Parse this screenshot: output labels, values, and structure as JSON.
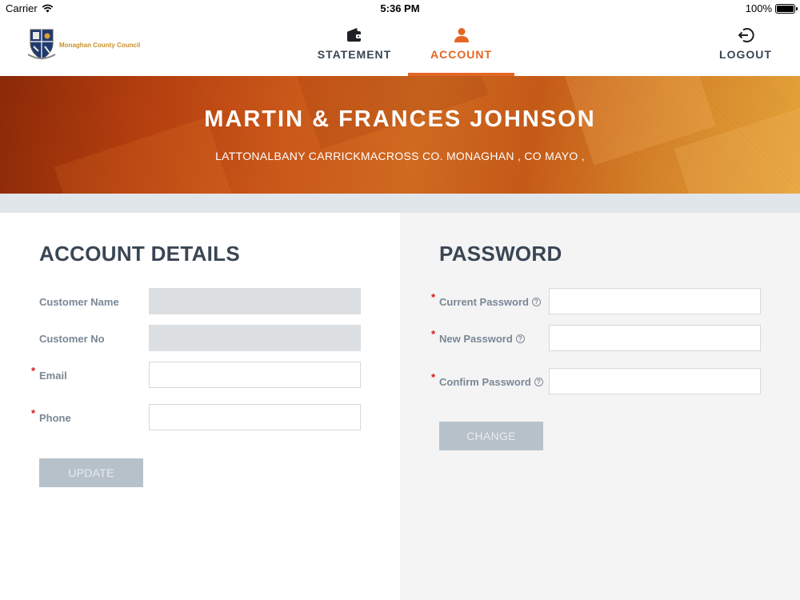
{
  "status_bar": {
    "carrier": "Carrier",
    "time": "5:36 PM",
    "battery": "100%"
  },
  "nav": {
    "logo_text": "Monaghan County Council",
    "tabs": [
      {
        "label": "STATEMENT",
        "icon": "wallet-icon",
        "active": false
      },
      {
        "label": "ACCOUNT",
        "icon": "person-icon",
        "active": true
      },
      {
        "label": "LOGOUT",
        "icon": "logout-icon",
        "active": false
      }
    ]
  },
  "banner": {
    "name": "MARTIN & FRANCES JOHNSON",
    "address": "LATTONALBANY CARRICKMACROSS CO. MONAGHAN , CO MAYO ,"
  },
  "account_details": {
    "title": "ACCOUNT DETAILS",
    "fields": [
      {
        "label": "Customer Name",
        "value": "",
        "required": false,
        "disabled": true
      },
      {
        "label": "Customer No",
        "value": "",
        "required": false,
        "disabled": true
      },
      {
        "label": "Email",
        "value": "",
        "required": true,
        "disabled": false
      },
      {
        "label": "Phone",
        "value": "",
        "required": true,
        "disabled": false
      }
    ],
    "button_label": "UPDATE"
  },
  "password": {
    "title": "PASSWORD",
    "fields": [
      {
        "label": "Current Password",
        "value": "",
        "required": true
      },
      {
        "label": "New Password",
        "value": "",
        "required": true
      },
      {
        "label": "Confirm Password",
        "value": "",
        "required": true
      }
    ],
    "button_label": "CHANGE"
  },
  "colors": {
    "accent": "#e46624",
    "heading": "#3a4654",
    "label": "#7a8796",
    "required": "#d9141b",
    "button_disabled": "#b7c1c9"
  }
}
